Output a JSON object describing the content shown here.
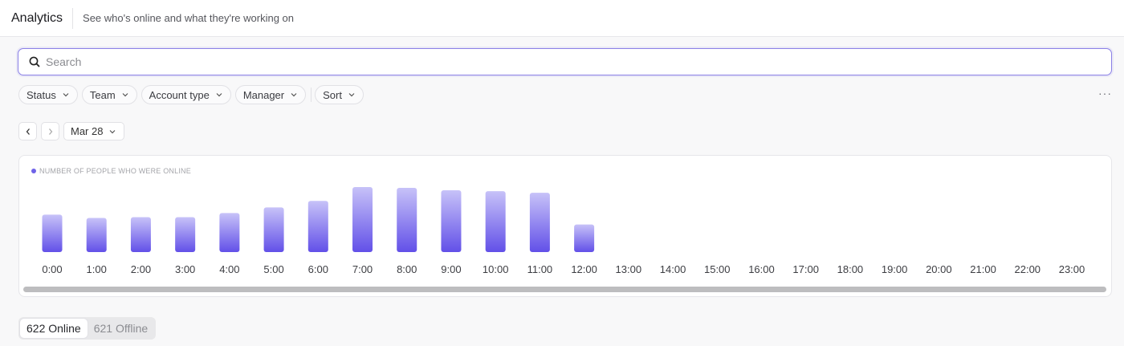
{
  "header": {
    "title": "Analytics",
    "subtitle": "See who's online and what they're working on"
  },
  "search": {
    "placeholder": "Search",
    "value": "",
    "icon": "search-icon"
  },
  "filters": [
    {
      "label": "Status"
    },
    {
      "label": "Team"
    },
    {
      "label": "Account type"
    },
    {
      "label": "Manager"
    },
    {
      "label": "Sort"
    }
  ],
  "more_label": "···",
  "date_nav": {
    "date": "Mar 28"
  },
  "chart_data": {
    "type": "bar",
    "title": "NUMBER OF PEOPLE WHO WERE ONLINE",
    "categories": [
      "0:00",
      "1:00",
      "2:00",
      "3:00",
      "4:00",
      "5:00",
      "6:00",
      "7:00",
      "8:00",
      "9:00",
      "10:00",
      "11:00",
      "12:00",
      "13:00",
      "14:00",
      "15:00",
      "16:00",
      "17:00",
      "18:00",
      "19:00",
      "20:00",
      "21:00",
      "22:00",
      "23:00"
    ],
    "values": [
      46,
      42,
      43,
      43,
      48,
      55,
      63,
      80,
      79,
      76,
      75,
      73,
      34,
      null,
      null,
      null,
      null,
      null,
      null,
      null,
      null,
      null,
      null,
      null
    ],
    "ylim": [
      0,
      80
    ],
    "colors": {
      "top": "#c7c2f8",
      "bottom": "#6250e8"
    },
    "grid": false
  },
  "status_toggle": {
    "online_label": "622 Online",
    "offline_label": "621 Offline",
    "selected": "online"
  }
}
